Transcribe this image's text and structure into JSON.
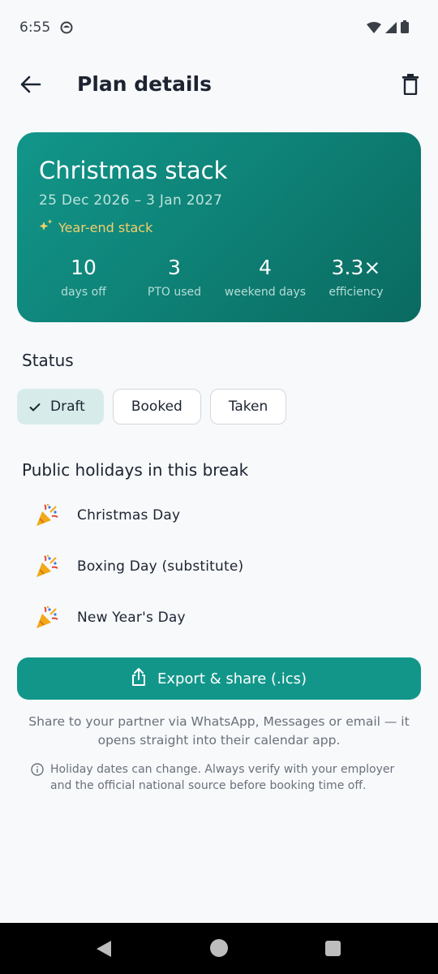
{
  "status_bar": {
    "time": "6:55"
  },
  "app_bar": {
    "title": "Plan details"
  },
  "plan": {
    "name": "Christmas stack",
    "date_range": "25 Dec 2026 – 3 Jan 2027",
    "tag": "Year-end stack",
    "stats": [
      {
        "value": "10",
        "label": "days off"
      },
      {
        "value": "3",
        "label": "PTO used"
      },
      {
        "value": "4",
        "label": "weekend days"
      },
      {
        "value": "3.3×",
        "label": "efficiency"
      }
    ]
  },
  "status_section": {
    "heading": "Status",
    "options": [
      {
        "label": "Draft",
        "selected": true
      },
      {
        "label": "Booked",
        "selected": false
      },
      {
        "label": "Taken",
        "selected": false
      }
    ]
  },
  "holidays_section": {
    "heading": "Public holidays in this break",
    "items": [
      {
        "name": "Christmas Day",
        "icon": "party-popper-icon"
      },
      {
        "name": "Boxing Day (substitute)",
        "icon": "party-popper-icon"
      },
      {
        "name": "New Year's Day",
        "icon": "party-popper-icon"
      }
    ]
  },
  "export": {
    "button_label": "Export & share (.ics)",
    "note": "Share to your partner via WhatsApp, Messages or email — it opens straight into their calendar app."
  },
  "disclaimer": "Holiday dates can change. Always verify with your employer and the official national source before booking time off.",
  "colors": {
    "accent": "#12968a",
    "hero_gradient_end": "#0a6a60",
    "tag_yellow": "#f2d06b",
    "chip_selected": "#d7ecea"
  }
}
